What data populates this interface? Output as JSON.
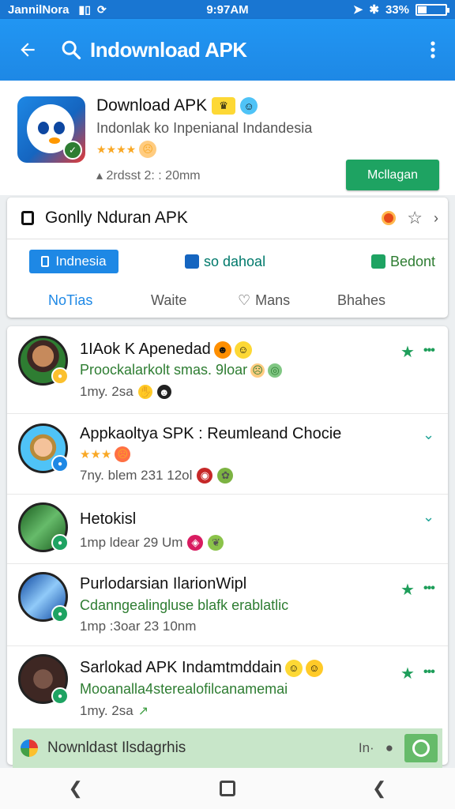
{
  "status": {
    "carrier": "JannilNora",
    "time": "9:97AM",
    "battery": "33%",
    "battery_level": 0.33
  },
  "appbar": {
    "title": "Indownload APK"
  },
  "header_app": {
    "name": "Download APK",
    "subtitle": "Indonlak ko Inpenianal Indandesia",
    "rating": "★★★★",
    "meta": "2rdsst 2: : 20mm",
    "install_label": "Mcllagan"
  },
  "filter": {
    "title": "Gonlly Nduran APK",
    "chips": [
      "Indnesia",
      "so dahoal",
      "Bedont"
    ],
    "tabs": [
      "NoTias",
      "Waite",
      "Mans",
      "Bhahes"
    ]
  },
  "items": [
    {
      "title": "1IAok K Apenedad",
      "subtitle": "Proockalarkolt smas. 9loar",
      "meta": "1my. 2sa"
    },
    {
      "title": "Appkaoltya SPK : Reumleand Chocie",
      "subtitle": "★★★",
      "meta": "7ny. blem 231 12ol"
    },
    {
      "title": "Hetokisl",
      "subtitle": "",
      "meta": "1mp ldear 29 Um"
    },
    {
      "title": "Purlodarsian IlarionWipl",
      "subtitle": "Cdanngealingluse blafk  erablatlic",
      "meta": "1mp :3oar 23 10nm"
    },
    {
      "title": "Sarlokad APK Indamtmddain",
      "subtitle": "Mooanalla4sterealofilcanamemai",
      "meta": "1my. 2sa"
    }
  ],
  "bottom": {
    "text": "Nownldast Ilsdagrhis",
    "right_label": "In·"
  },
  "colors": {
    "primary": "#1e88e5",
    "accent": "#1ea362",
    "rating": "#f9a825"
  }
}
